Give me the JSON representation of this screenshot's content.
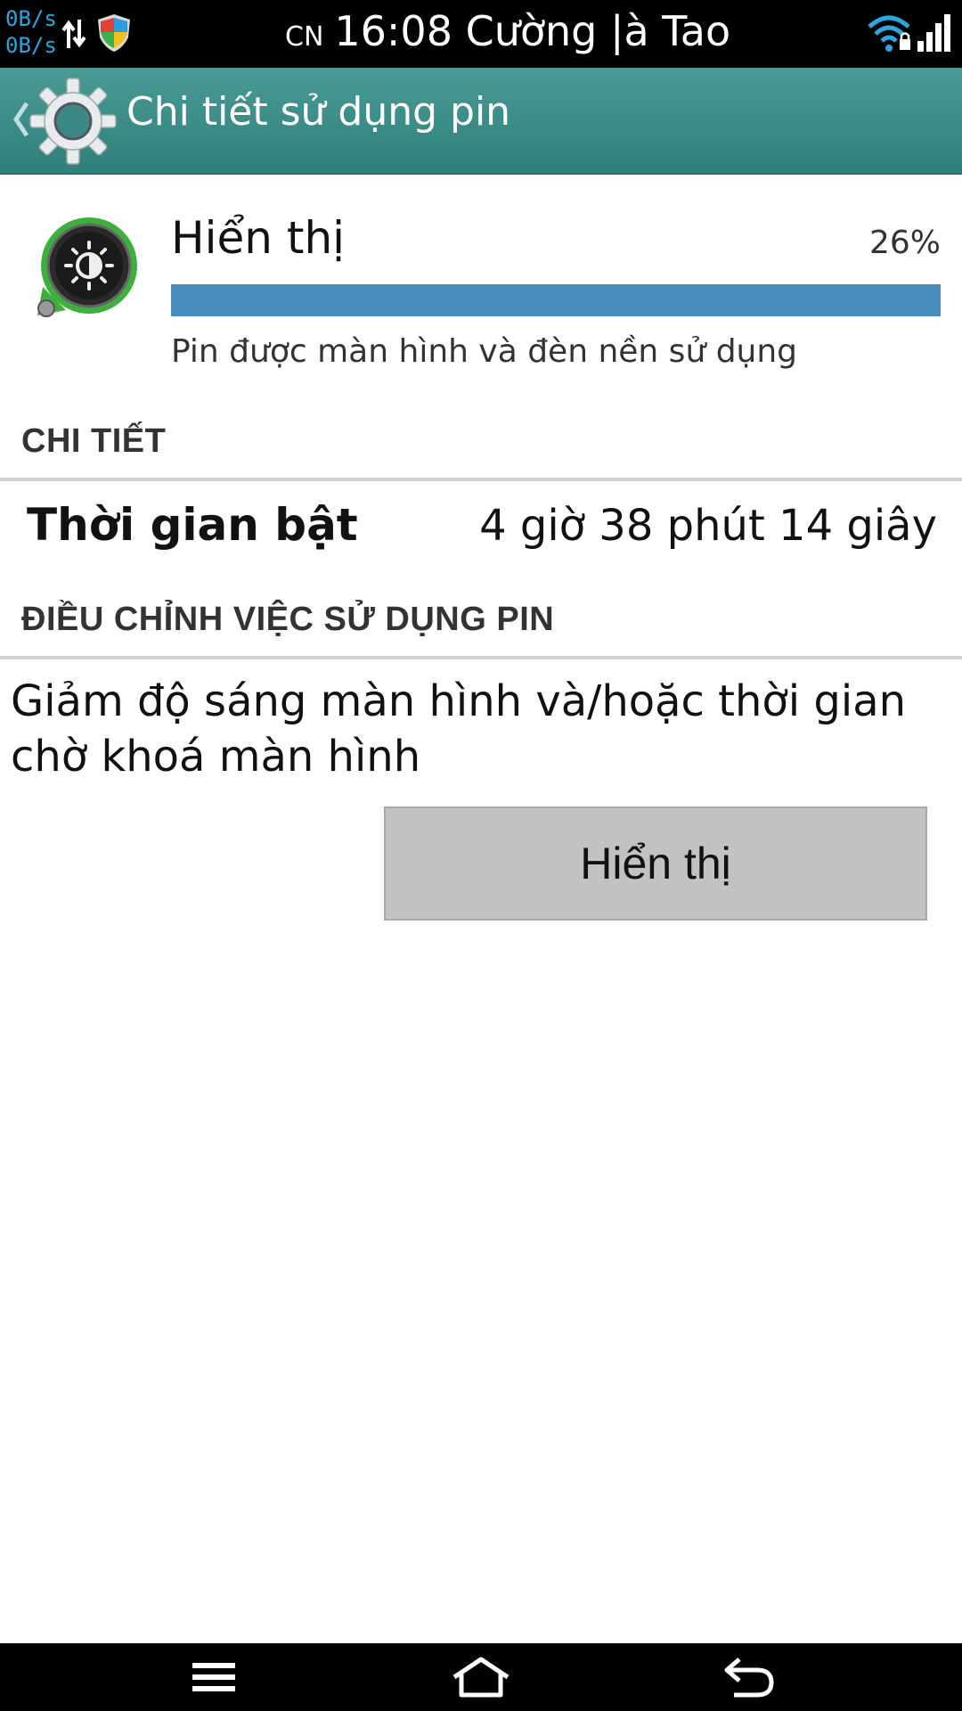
{
  "status_bar": {
    "net_up": "0B/s",
    "net_down": "0B/s",
    "day": "CN",
    "time_carrier": "16:08 Cường |à Tao",
    "icons": [
      "data-arrows-icon",
      "shield-icon",
      "wifi-icon",
      "signal-icon"
    ]
  },
  "action_bar": {
    "title": "Chi tiết sử dụng pin",
    "icons": [
      "back-chevron-icon",
      "gear-icon"
    ],
    "color": "#3d8c88"
  },
  "usage": {
    "name": "Hiển thị",
    "percent_label": "26%",
    "bar_fill_fraction": 1.0,
    "bar_color": "#4a8cbd",
    "description": "Pin được màn hình và đèn nền sử dụng"
  },
  "details": {
    "header": "CHI TIẾT",
    "rows": [
      {
        "label": "Thời gian bật",
        "value": "4 giờ 38 phút 14 giây"
      }
    ]
  },
  "adjust": {
    "header": "ĐIỀU CHỈNH VIỆC SỬ DỤNG PIN",
    "text": "Giảm độ sáng màn hình và/hoặc thời gian chờ khoá màn hình",
    "button_label": "Hiển thị"
  },
  "nav_bar": {
    "icons": [
      "menu-icon",
      "home-icon",
      "back-icon"
    ]
  }
}
